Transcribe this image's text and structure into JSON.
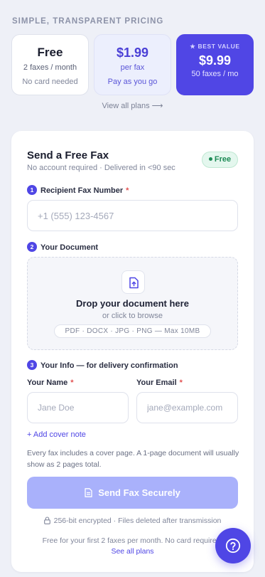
{
  "pricing": {
    "eyebrow": "SIMPLE, TRANSPARENT PRICING",
    "plans": [
      {
        "title": "Free",
        "subtitle": "2 faxes / month",
        "note": "No card needed"
      },
      {
        "title": "$1.99",
        "subtitle": "per fax",
        "note": "Pay as you go"
      },
      {
        "badge": "★ BEST VALUE",
        "title": "$9.99",
        "subtitle": "50 faxes / mo"
      }
    ],
    "view_all": "View all plans ⟶"
  },
  "form": {
    "title": "Send a Free Fax",
    "subtitle": "No account required · Delivered in <90 sec",
    "badge": "Free",
    "step1": {
      "num": "1",
      "label": "Recipient Fax Number",
      "required": "*",
      "placeholder": "+1 (555) 123-4567"
    },
    "step2": {
      "num": "2",
      "label": "Your Document",
      "drop_title": "Drop your document here",
      "drop_sub": "or click to browse",
      "formats": "PDF · DOCX · JPG · PNG — Max 10MB"
    },
    "step3": {
      "num": "3",
      "label": "Your Info — for delivery confirmation",
      "name_label": "Your Name",
      "name_placeholder": "Jane Doe",
      "email_label": "Your Email",
      "email_placeholder": "jane@example.com",
      "required": "*"
    },
    "cover_link": "+ Add cover note",
    "note": "Every fax includes a cover page. A 1-page document will usually show as 2 pages total.",
    "send_label": "Send Fax Securely",
    "secure_text": "256-bit encrypted · Files deleted after transmission",
    "footnote": "Free for your first 2 faxes per month. No card required.",
    "see_all": "See all plans"
  },
  "colors": {
    "accent": "#4f46e5",
    "best_value_bg": "#5046e5",
    "send_button_disabled": "#a9b1fb",
    "free_badge": "#1d8a55",
    "required": "#e25151"
  },
  "icons": {
    "upload": "upload-file-icon",
    "send": "document-icon",
    "lock": "lock-icon",
    "help": "help-icon"
  }
}
